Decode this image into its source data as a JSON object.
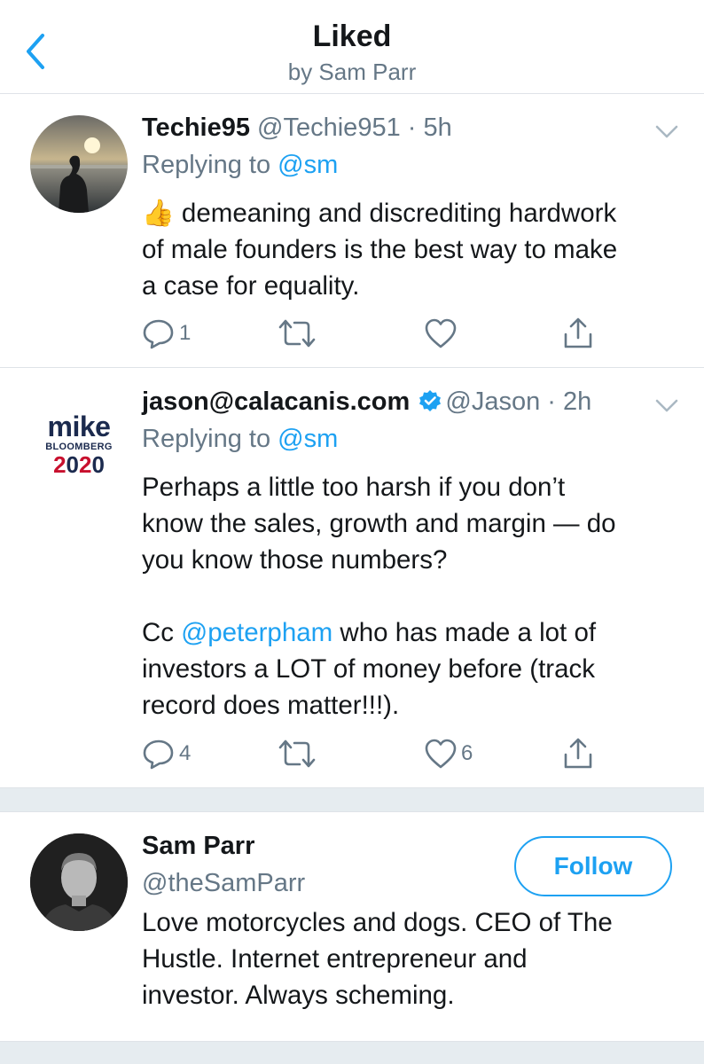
{
  "header": {
    "title": "Liked",
    "subtitle": "by Sam Parr"
  },
  "tweets": [
    {
      "name": "Techie95",
      "handle": "@Techie951",
      "time": "5h",
      "replying_prefix": "Replying to",
      "replying_to": "@sm",
      "emoji": "👍",
      "lines": [
        " demeaning and discrediting hardwork",
        "of male founders is the best way to make",
        "a case for equality."
      ],
      "reply_count": "1",
      "retweet_count": "",
      "like_count": ""
    },
    {
      "name": "jason@calacanis.com",
      "handle": "@Jason",
      "time": "2h",
      "verified": true,
      "avatar_text": {
        "line1": "mike",
        "line2": "BLOOMBERG",
        "line3": "2020"
      },
      "replying_prefix": "Replying to",
      "replying_to": "@sm",
      "para1": [
        "Perhaps a little too harsh if you don’t",
        "know the sales, growth and margin — do",
        "you know those numbers?"
      ],
      "para2_prefix": "Cc ",
      "para2_mention": "@peterpham",
      "para2_line1_rest": " who has made a lot of",
      "para2_lines": [
        "investors a LOT of money before (track",
        "record does matter!!!)."
      ],
      "reply_count": "4",
      "retweet_count": "",
      "like_count": "6"
    }
  ],
  "profile": {
    "name": "Sam Parr",
    "handle": "@theSamParr",
    "follow_label": "Follow",
    "bio_lines": [
      "Love motorcycles and dogs. CEO of The",
      "Hustle. Internet entrepreneur and",
      "investor. Always scheming."
    ]
  },
  "colors": {
    "accent": "#1da1f2",
    "secondary": "#657786",
    "divider": "#e6ecf0",
    "bloomberg_navy": "#1b2a4e",
    "bloomberg_red": "#c8102e"
  }
}
